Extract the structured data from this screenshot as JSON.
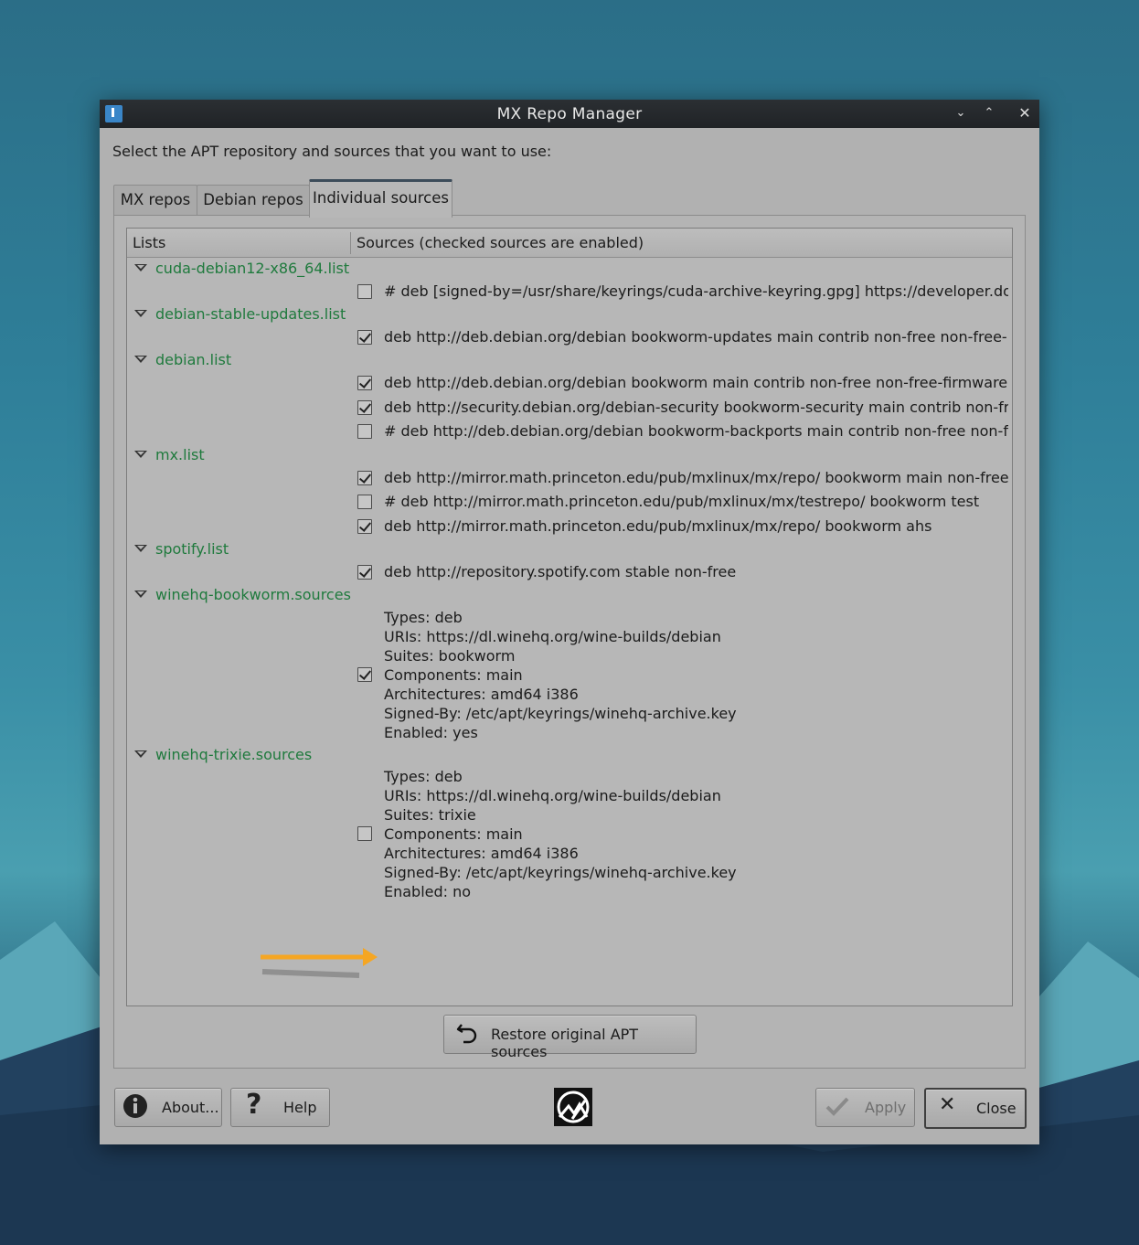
{
  "window": {
    "title": "MX Repo Manager"
  },
  "instruction": "Select the APT repository and sources that you want to use:",
  "tabs": [
    {
      "label": "MX repos"
    },
    {
      "label": "Debian repos"
    },
    {
      "label": "Individual sources"
    }
  ],
  "tree": {
    "headers": {
      "lists": "Lists",
      "sources": "Sources (checked sources are enabled)"
    },
    "lists": [
      {
        "name": "cuda-debian12-x86_64.list"
      },
      {
        "name": "debian-stable-updates.list"
      },
      {
        "name": "debian.list"
      },
      {
        "name": "mx.list"
      },
      {
        "name": "spotify.list"
      },
      {
        "name": "winehq-bookworm.sources"
      },
      {
        "name": "winehq-trixie.sources"
      }
    ],
    "sources": [
      {
        "text": "# deb [signed-by=/usr/share/keyrings/cuda-archive-keyring.gpg] https://developer.do…",
        "checked": false
      },
      {
        "text": "deb http://deb.debian.org/debian bookworm-updates main contrib non-free non-free-…",
        "checked": true
      },
      {
        "text": "deb http://deb.debian.org/debian bookworm main contrib non-free non-free-firmware",
        "checked": true
      },
      {
        "text": "deb http://security.debian.org/debian-security bookworm-security main contrib non-fr…",
        "checked": true
      },
      {
        "text": "# deb http://deb.debian.org/debian bookworm-backports main contrib non-free non-fr…",
        "checked": false
      },
      {
        "text": "deb http://mirror.math.princeton.edu/pub/mxlinux/mx/repo/ bookworm main non-free",
        "checked": true
      },
      {
        "text": "# deb http://mirror.math.princeton.edu/pub/mxlinux/mx/testrepo/ bookworm test",
        "checked": false
      },
      {
        "text": "deb http://mirror.math.princeton.edu/pub/mxlinux/mx/repo/ bookworm ahs",
        "checked": true
      },
      {
        "text": "deb http://repository.spotify.com stable non-free",
        "checked": true
      }
    ],
    "bookworm_block": {
      "checked": true,
      "lines": [
        "Types: deb",
        "URIs: https://dl.winehq.org/wine-builds/debian",
        "Suites: bookworm",
        "Components: main",
        "Architectures: amd64 i386",
        "Signed-By: /etc/apt/keyrings/winehq-archive.key",
        "Enabled: yes"
      ]
    },
    "trixie_block": {
      "checked": false,
      "lines": [
        "Types: deb",
        "URIs: https://dl.winehq.org/wine-builds/debian",
        "Suites: trixie",
        "Components: main",
        "Architectures: amd64 i386",
        "Signed-By: /etc/apt/keyrings/winehq-archive.key",
        "Enabled: no"
      ]
    }
  },
  "buttons": {
    "restore": "Restore original APT sources",
    "about": "About...",
    "help": "Help",
    "apply": "Apply",
    "close": "Close"
  },
  "colors": {
    "list_name": "#1f7a3d",
    "annotation_arrow": "#f5a623",
    "titlebar": "#202326"
  }
}
